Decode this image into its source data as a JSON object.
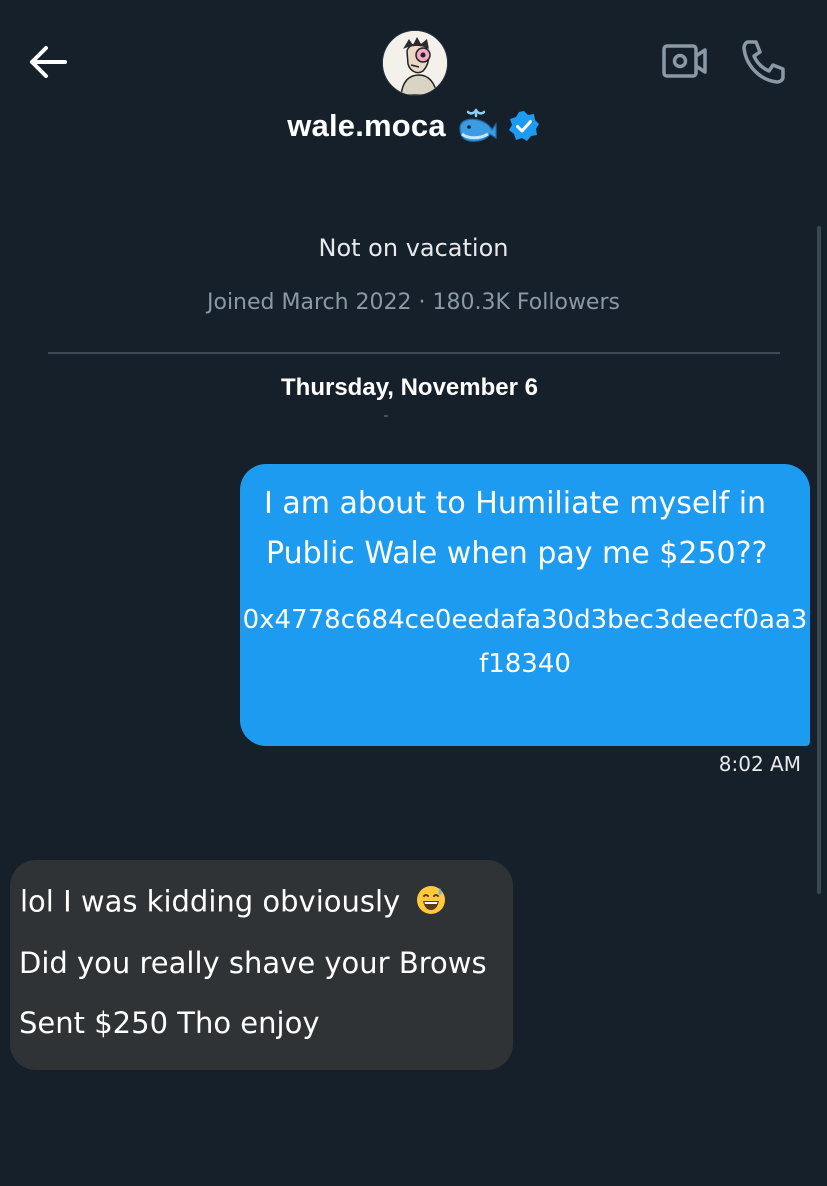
{
  "header": {
    "back_icon": "arrow-left-icon",
    "avatar_icon": "avatar-illustration",
    "name": "wale.moca",
    "name_emoji": "🐳",
    "verified_icon": "verified-badge-icon",
    "video_icon": "video-call-icon",
    "call_icon": "phone-icon"
  },
  "profile": {
    "bio": "Not on vacation",
    "meta": "Joined March 2022 · 180.3K Followers"
  },
  "conversation": {
    "date_label": "Thursday, November 6",
    "messages": [
      {
        "direction": "outgoing",
        "line1": "I am about to Humiliate myself in",
        "line2": "Public Wale when pay me $250??",
        "address": "0x4778c684ce0eedafa30d3bec3deecf0aa3f18340",
        "time": "8:02 AM"
      },
      {
        "direction": "incoming",
        "line1": "lol I was kidding obviously",
        "line1_emoji": "😅",
        "line2": "Did you really shave your Brows",
        "line3": "Sent $250 Tho enjoy"
      }
    ]
  },
  "colors": {
    "background": "#15202b",
    "outgoing_bubble": "#1d9bf0",
    "incoming_bubble": "#2f3336",
    "muted_text": "#8b98a5",
    "verified": "#1d9bf0"
  }
}
